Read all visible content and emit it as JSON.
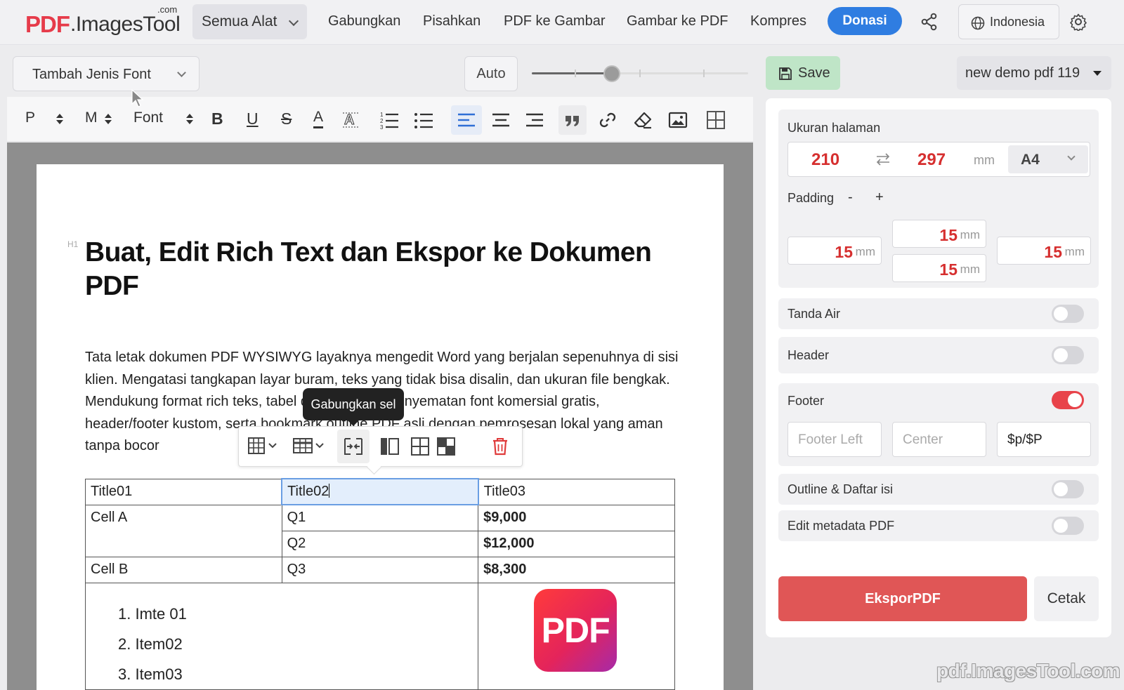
{
  "site": {
    "logo_pdf": "PDF",
    "logo_rest": ".ImagesTool",
    "logo_com": ".com",
    "all_tools": "Semua Alat",
    "nav": [
      "Gabungkan",
      "Pisahkan",
      "PDF ke Gambar",
      "Gambar ke PDF",
      "Kompres"
    ],
    "donate": "Donasi",
    "language": "Indonesia",
    "accent_color": "#2f7de1"
  },
  "editor": {
    "font_select": "Tambah Jenis Font",
    "auto_label": "Auto",
    "zoom_level": 0.37,
    "toolbar": {
      "block_type": "P",
      "size": "M",
      "font": "Font",
      "bold": "B",
      "underline": "U",
      "strike": "S",
      "text_color": "A"
    }
  },
  "document": {
    "heading_tag": "H1",
    "heading": "Buat, Edit Rich Text dan Ekspor ke Dokumen PDF",
    "paragraph": "Tata letak dokumen PDF WYSIWYG layaknya mengedit Word yang berjalan sepenuhnya di sisi klien. Mengatasi tangkapan layar buram, teks yang tidak bisa disalin, dan ukuran file bengkak. Mendukung format rich teks, tabel data lanjutan, penyematan font komersial gratis, header/footer kustom, serta bookmark outline PDF asli dengan pemrosesan lokal yang aman tanpa bocor",
    "tooltip": "Gabungkan sel",
    "table": {
      "headers": [
        "Title01",
        "Title02",
        "Title03"
      ],
      "rows": [
        [
          "Cell A",
          "Q1",
          "$9,000"
        ],
        [
          "",
          "Q2",
          "$12,000"
        ],
        [
          "Cell B",
          "Q3",
          "$8,300"
        ]
      ],
      "list_items": [
        "1. Imte 01",
        "2. Item02",
        "3. Item03"
      ],
      "image_text": "PDF"
    }
  },
  "panel": {
    "save": "Save",
    "doc_name": "new demo pdf 119",
    "page_size_label": "Ukuran halaman",
    "width": "210",
    "height": "297",
    "unit": "mm",
    "paper": "A4",
    "padding_label": "Padding",
    "padding_minus": "-",
    "padding_plus": "+",
    "padding": {
      "top": "15",
      "left": "15",
      "bottom": "15",
      "right": "15"
    },
    "watermark_label": "Tanda Air",
    "header_label": "Header",
    "footer_label": "Footer",
    "footer_left_placeholder": "Footer Left",
    "footer_center_placeholder": "Center",
    "footer_right_value": "$p/$P",
    "outline_label": "Outline & Daftar isi",
    "metadata_label": "Edit metadata PDF",
    "toggles": {
      "watermark": false,
      "header": false,
      "footer": true,
      "outline": false,
      "metadata": false
    },
    "export": "EksporPDF",
    "print": "Cetak",
    "accent_red": "#e05656"
  },
  "watermark_text": "pdf.ImagesTool.com"
}
